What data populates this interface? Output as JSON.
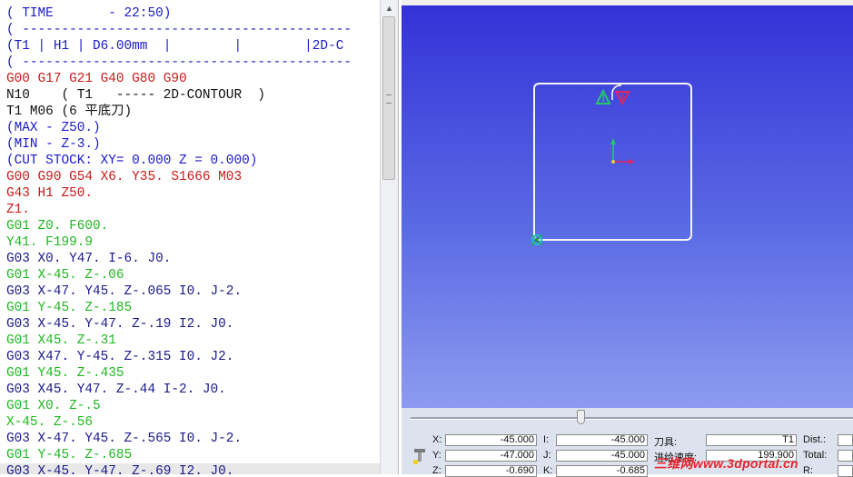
{
  "editor": {
    "lines": [
      {
        "text": "( TIME       - 22:50)",
        "color": "comment"
      },
      {
        "text": "( ------------------------------------------",
        "color": "comment"
      },
      {
        "text": "(T1 | H1 | D6.00mm  |        |        |2D-C",
        "color": "comment"
      },
      {
        "text": "( ------------------------------------------",
        "color": "comment"
      },
      {
        "text": "G00 G17 G21 G40 G80 G90",
        "color": "red"
      },
      {
        "text": "N10    ( T1   ----- 2D-CONTOUR  )",
        "color": "black"
      },
      {
        "text": "T1 M06 (6 平底刀)",
        "color": "black"
      },
      {
        "text": "(MAX - Z50.)",
        "color": "comment"
      },
      {
        "text": "(MIN - Z-3.)",
        "color": "comment"
      },
      {
        "text": "(CUT STOCK: XY= 0.000 Z = 0.000)",
        "color": "comment"
      },
      {
        "text": "G00 G90 G54 X6. Y35. S1666 M03",
        "color": "red"
      },
      {
        "text": "G43 H1 Z50.",
        "color": "red"
      },
      {
        "text": "Z1.",
        "color": "red"
      },
      {
        "text": "G01 Z0. F600.",
        "color": "green"
      },
      {
        "text": "Y41. F199.9",
        "color": "green"
      },
      {
        "text": "G03 X0. Y47. I-6. J0.",
        "color": "darkblue"
      },
      {
        "text": "G01 X-45. Z-.06",
        "color": "green"
      },
      {
        "text": "G03 X-47. Y45. Z-.065 I0. J-2.",
        "color": "darkblue"
      },
      {
        "text": "G01 Y-45. Z-.185",
        "color": "green"
      },
      {
        "text": "G03 X-45. Y-47. Z-.19 I2. J0.",
        "color": "darkblue"
      },
      {
        "text": "G01 X45. Z-.31",
        "color": "green"
      },
      {
        "text": "G03 X47. Y-45. Z-.315 I0. J2.",
        "color": "darkblue"
      },
      {
        "text": "G01 Y45. Z-.435",
        "color": "green"
      },
      {
        "text": "G03 X45. Y47. Z-.44 I-2. J0.",
        "color": "darkblue"
      },
      {
        "text": "G01 X0. Z-.5",
        "color": "green"
      },
      {
        "text": "X-45. Z-.56",
        "color": "green"
      },
      {
        "text": "G03 X-47. Y45. Z-.565 I0. J-2.",
        "color": "darkblue"
      },
      {
        "text": "G01 Y-45. Z-.685",
        "color": "green"
      },
      {
        "text": "G03 X-45. Y-47. Z-.69 I2. J0.",
        "color": "darkblue",
        "selected": true
      }
    ]
  },
  "viewport": {
    "bg_top": "#3432d8",
    "bg_bottom": "#8e9bf0",
    "path_color": "#f4f4f4",
    "marker_start_color": "#28c76f",
    "marker_end_color": "#e0245e",
    "tool_color": "#19c4c4"
  },
  "readout": {
    "x_label": "X:",
    "x_value": "-45.000",
    "y_label": "Y:",
    "y_value": "-47.000",
    "z_label": "Z:",
    "z_value": "-0.690",
    "i_label": "I:",
    "i_value": "-45.000",
    "j_label": "J:",
    "j_value": "-45.000",
    "k_label": "K:",
    "k_value": "-0.685",
    "tool_label": "刀具:",
    "tool_value": "T1",
    "feed_label": "进给速度:",
    "feed_value": "199.900",
    "dist_label": "Dist.:",
    "total_label": "Total:",
    "r_label": "R:"
  },
  "watermark": "三维网www.3dportal.cn",
  "icons": {
    "scroll_up": "triangle-up-icon",
    "tool": "tool-icon"
  }
}
